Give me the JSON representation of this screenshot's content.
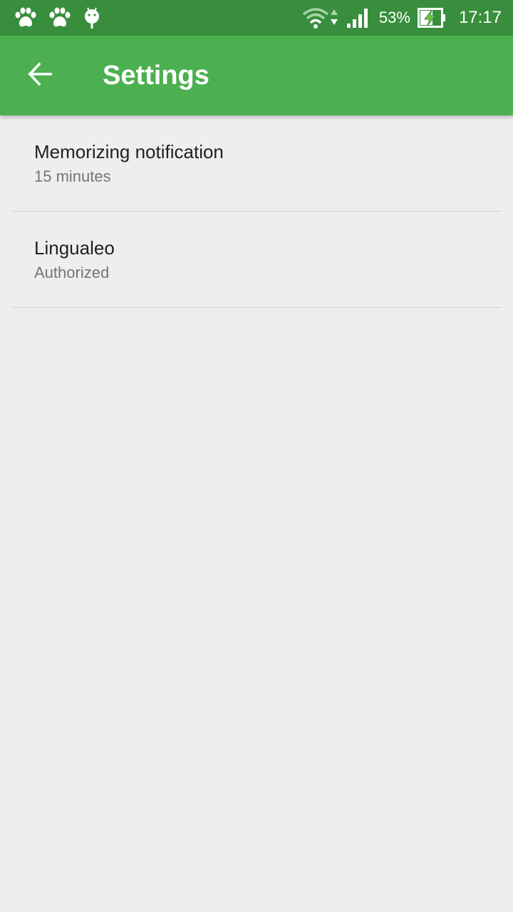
{
  "status_bar": {
    "left_icons": [
      "paw-icon",
      "paw-icon",
      "android-icon"
    ],
    "right_icons": [
      "wifi-icon",
      "data-transfer-icon",
      "signal-icon",
      "battery-charging-icon"
    ],
    "battery_percent": "53%",
    "time": "17:17"
  },
  "app_bar": {
    "back_icon": "arrow-back-icon",
    "title": "Settings"
  },
  "preferences": [
    {
      "title": "Memorizing notification",
      "summary": "15 minutes"
    },
    {
      "title": "Lingualeo",
      "summary": "Authorized"
    }
  ],
  "colors": {
    "status_bar": "#388e3c",
    "app_bar": "#4caf50",
    "background": "#eeeeee",
    "title_text": "#212121",
    "summary_text": "#757575",
    "divider": "#d4d4d4"
  }
}
